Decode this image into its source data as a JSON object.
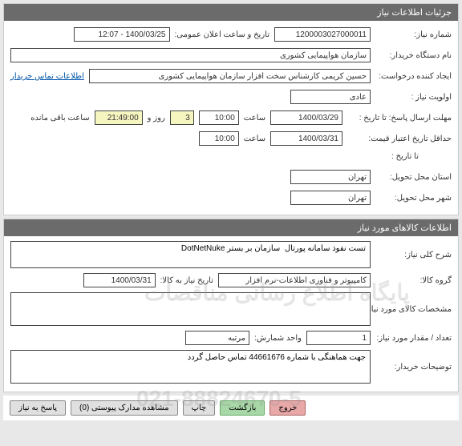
{
  "section1": {
    "title": "جزئیات اطلاعات نیاز",
    "need_no_label": "شماره نیاز:",
    "need_no": "1200003027000011",
    "pub_time_label": "تاریخ و ساعت اعلان عمومی:",
    "pub_time": "1400/03/25 - 12:07",
    "buyer_org_label": "نام دستگاه خریدار:",
    "buyer_org": "سازمان هواپیمایی کشوری",
    "creator_label": "ایجاد کننده درخواست:",
    "creator": "حسین کریمی کارشناس سخت افزار سازمان هواپیمایی کشوری",
    "buyer_contact_link": "اطلاعات تماس خریدار",
    "priority_label": "اولویت نیاز :",
    "priority": "عادی",
    "resp_deadline_label": "مهلت ارسال پاسخ:",
    "until_date_label": "تا تاریخ :",
    "resp_until_date": "1400/03/29",
    "time_label": "ساعت",
    "resp_until_time": "10:00",
    "days_remain": "3",
    "day_and_label": "روز و",
    "time_remain": "21:49:00",
    "remain_suffix": "ساعت باقی مانده",
    "min_valid_label": "حداقل تاریخ اعتبار قیمت:",
    "min_valid_date": "1400/03/31",
    "min_valid_time": "10:00",
    "deliver_province_label": "استان محل تحویل:",
    "deliver_province": "تهران",
    "deliver_city_label": "شهر محل تحویل:",
    "deliver_city": "تهران"
  },
  "section2": {
    "title": "اطلاعات کالاهای مورد نیاز",
    "general_desc_label": "شرح کلی نیاز:",
    "general_desc": "تست نفوذ سامانه پورتال  سازمان بر بستر DotNetNuke",
    "group_label": "گروه کالا:",
    "group": "کامپیوتر و فناوری اطلاعات-نرم افزار",
    "need_by_label": "تاریخ نیاز به کالا:",
    "need_by": "1400/03/31",
    "specs_label": "مشخصات کالای مورد نیاز:",
    "specs": "",
    "qty_label": "تعداد / مقدار مورد نیاز:",
    "qty": "1",
    "unit_label": "واحد شمارش:",
    "unit": "مرتبه",
    "buyer_notes_label": "توضیحات خریدار:",
    "buyer_notes": "جهت هماهنگی با شماره 44661676 تماس حاصل گردد"
  },
  "buttons": {
    "respond": "پاسخ به نیاز",
    "attachments": "مشاهده مدارک پیوستی (0)",
    "print": "چاپ",
    "back": "بازگشت",
    "exit": "خروج"
  },
  "watermark1": "پایگاه اطلاع رسانی مناقصات",
  "watermark2": "021-88824670-5"
}
